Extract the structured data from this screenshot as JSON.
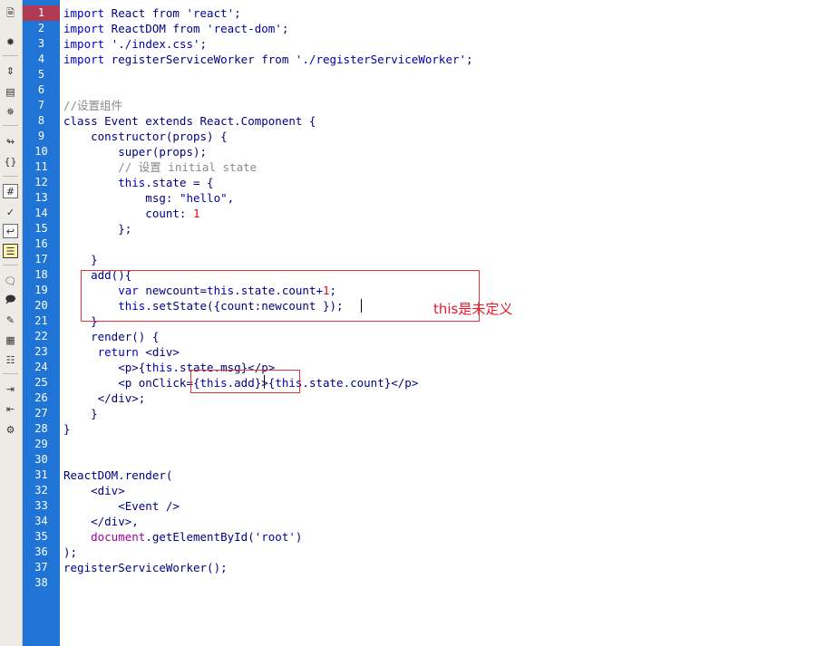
{
  "editor": {
    "line_numbers": [
      "1",
      "2",
      "3",
      "4",
      "5",
      "6",
      "7",
      "8",
      "9",
      "10",
      "11",
      "12",
      "13",
      "14",
      "15",
      "16",
      "17",
      "18",
      "19",
      "20",
      "21",
      "22",
      "23",
      "24",
      "25",
      "26",
      "27",
      "28",
      "29",
      "30",
      "31",
      "32",
      "33",
      "34",
      "35",
      "36",
      "37",
      "38"
    ],
    "current_line": "1"
  },
  "code": [
    [
      {
        "c": "kw",
        "t": "import"
      },
      {
        "c": "",
        "t": " React from "
      },
      {
        "c": "str",
        "t": "'react'"
      },
      {
        "c": "",
        "t": ";"
      }
    ],
    [
      {
        "c": "kw",
        "t": "import"
      },
      {
        "c": "",
        "t": " ReactDOM from "
      },
      {
        "c": "str",
        "t": "'react-dom'"
      },
      {
        "c": "",
        "t": ";"
      }
    ],
    [
      {
        "c": "kw",
        "t": "import"
      },
      {
        "c": "",
        "t": " "
      },
      {
        "c": "str",
        "t": "'./index.css'"
      },
      {
        "c": "",
        "t": ";"
      }
    ],
    [
      {
        "c": "kw",
        "t": "import"
      },
      {
        "c": "",
        "t": " registerServiceWorker from "
      },
      {
        "c": "str",
        "t": "'./registerServiceWorker'"
      },
      {
        "c": "",
        "t": ";"
      }
    ],
    [],
    [],
    [
      {
        "c": "cm",
        "t": "//设置组件"
      }
    ],
    [
      {
        "c": "",
        "t": "class Event extends React.Component {"
      }
    ],
    [
      {
        "c": "",
        "t": "    constructor(props) {"
      }
    ],
    [
      {
        "c": "",
        "t": "        super(props);"
      }
    ],
    [
      {
        "c": "cm",
        "t": "        // 设置 initial state"
      }
    ],
    [
      {
        "c": "kw",
        "t": "        this"
      },
      {
        "c": "",
        "t": ".state = {"
      }
    ],
    [
      {
        "c": "",
        "t": "            msg: "
      },
      {
        "c": "str",
        "t": "\"hello\""
      },
      {
        "c": "",
        "t": ","
      }
    ],
    [
      {
        "c": "",
        "t": "            count: "
      },
      {
        "c": "num",
        "t": "1"
      }
    ],
    [
      {
        "c": "",
        "t": "        };"
      }
    ],
    [],
    [
      {
        "c": "",
        "t": "    }"
      }
    ],
    [
      {
        "c": "",
        "t": "    add(){"
      }
    ],
    [
      {
        "c": "kw",
        "t": "        var"
      },
      {
        "c": "",
        "t": " newcount="
      },
      {
        "c": "kw",
        "t": "this"
      },
      {
        "c": "",
        "t": ".state.count+"
      },
      {
        "c": "num",
        "t": "1"
      },
      {
        "c": "",
        "t": ";"
      }
    ],
    [
      {
        "c": "kw",
        "t": "        this"
      },
      {
        "c": "",
        "t": ".setState({count:newcount });"
      }
    ],
    [
      {
        "c": "",
        "t": "    }"
      }
    ],
    [
      {
        "c": "",
        "t": "    render() {"
      }
    ],
    [
      {
        "c": "kw",
        "t": "     return"
      },
      {
        "c": "",
        "t": " <div>"
      }
    ],
    [
      {
        "c": "",
        "t": "        <p>{"
      },
      {
        "c": "kw",
        "t": "this"
      },
      {
        "c": "",
        "t": ".state.msg}</p>"
      }
    ],
    [
      {
        "c": "",
        "t": "        <p onClick={"
      },
      {
        "c": "kw",
        "t": "this"
      },
      {
        "c": "",
        "t": ".add}>{"
      },
      {
        "c": "kw",
        "t": "this"
      },
      {
        "c": "",
        "t": ".state.count}</p>"
      }
    ],
    [
      {
        "c": "",
        "t": "     </div>;"
      }
    ],
    [
      {
        "c": "",
        "t": "    }"
      }
    ],
    [
      {
        "c": "",
        "t": "}"
      }
    ],
    [],
    [],
    [
      {
        "c": "",
        "t": "ReactDOM.render("
      }
    ],
    [
      {
        "c": "",
        "t": "    <div>"
      }
    ],
    [
      {
        "c": "",
        "t": "        <Event />"
      }
    ],
    [
      {
        "c": "",
        "t": "    </div>,"
      }
    ],
    [
      {
        "c": "fn",
        "t": "    document"
      },
      {
        "c": "",
        "t": ".getElementById("
      },
      {
        "c": "str",
        "t": "'root'"
      },
      {
        "c": "",
        "t": ")"
      }
    ],
    [
      {
        "c": "",
        "t": ");"
      }
    ],
    [
      {
        "c": "",
        "t": "registerServiceWorker();"
      }
    ],
    []
  ],
  "annotation": {
    "text": "this是未定义"
  },
  "toolbar": {
    "icons": [
      "file-icon",
      "settings-icon",
      "expand-all-icon",
      "select-block-icon",
      "collapse-icon",
      "jump-icon",
      "brace-balance-icon",
      "line-numbers-icon",
      "syntax-check-icon",
      "word-wrap-icon",
      "highlight-icon",
      "comment-icon",
      "uncomment-icon",
      "edit-icon",
      "snippet-icon",
      "table-icon",
      "indent-icon",
      "outdent-icon",
      "format-icon"
    ]
  },
  "colors": {
    "gutter": "#1f74d6",
    "current_line": "#b03a52",
    "keyword": "#0000c0",
    "comment": "#8a8a8a",
    "number": "#e8001c",
    "annotation": "#e8182c"
  }
}
